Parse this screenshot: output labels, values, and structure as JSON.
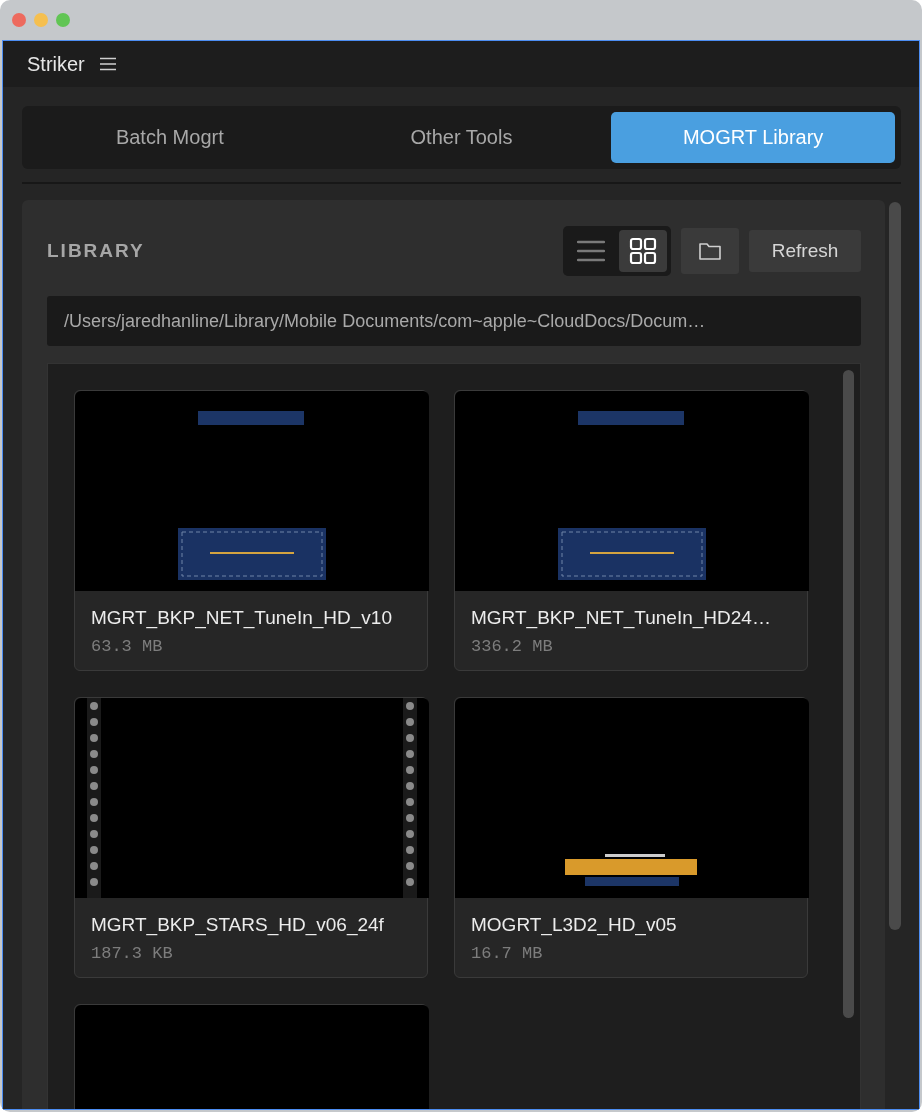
{
  "app": {
    "title": "Striker"
  },
  "tabs": [
    {
      "label": "Batch Mogrt",
      "selected": false
    },
    {
      "label": "Other Tools",
      "selected": false
    },
    {
      "label": "MOGRT Library",
      "selected": true
    }
  ],
  "library": {
    "heading": "LIBRARY",
    "views": [
      {
        "kind": "list",
        "selected": false
      },
      {
        "kind": "grid",
        "selected": true
      }
    ],
    "refresh_button": "Refresh",
    "path": "/Users/jaredhanline/Library/Mobile Documents/com~apple~CloudDocs/Docum…",
    "items": [
      {
        "name": "MGRT_BKP_NET_TuneIn_HD_v10",
        "size": "63.3 MB"
      },
      {
        "name": "MGRT_BKP_NET_TuneIn_HD24…",
        "size": "336.2 MB"
      },
      {
        "name": "MGRT_BKP_STARS_HD_v06_24f",
        "size": "187.3 KB"
      },
      {
        "name": "MOGRT_L3D2_HD_v05",
        "size": "16.7 MB"
      },
      {
        "kind": "picture"
      }
    ]
  }
}
